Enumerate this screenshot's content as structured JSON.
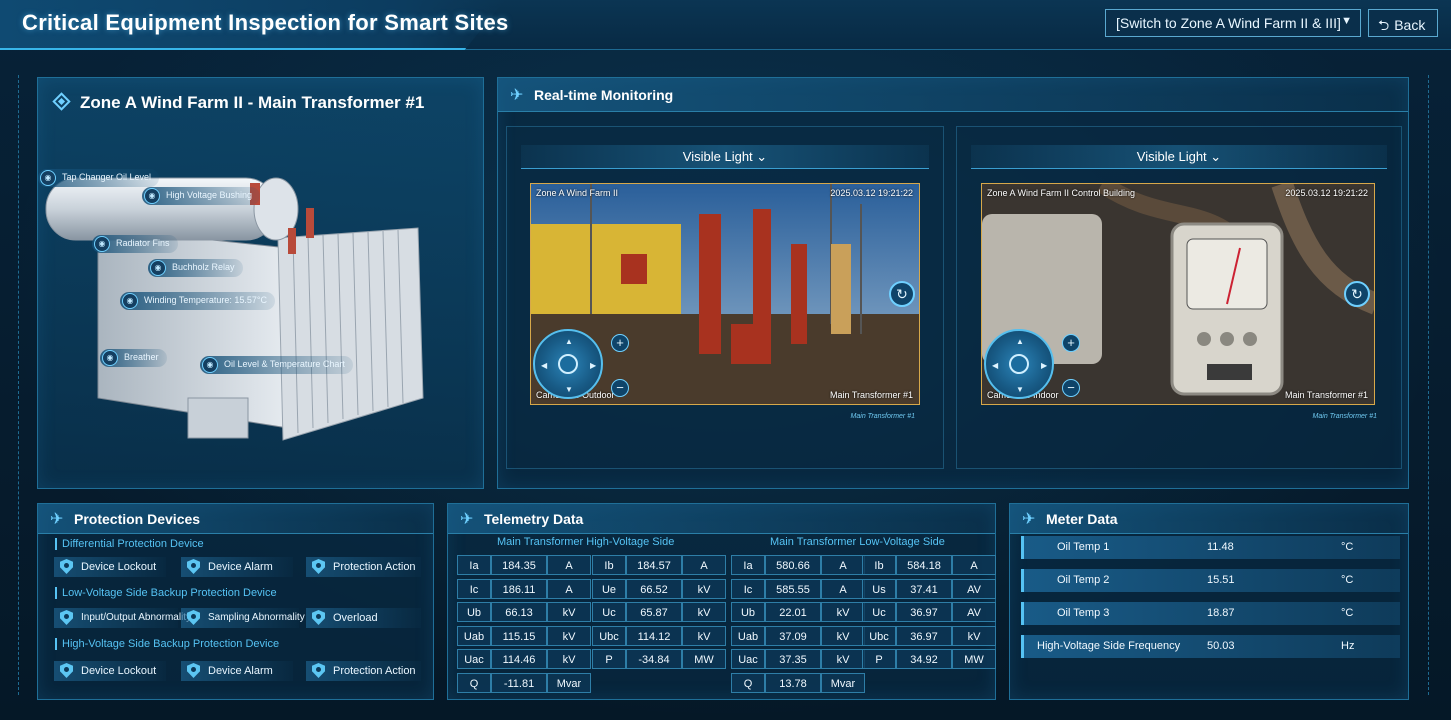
{
  "header": {
    "title": "Critical Equipment Inspection for Smart Sites",
    "switch_label": "[Switch to Zone A Wind Farm II & III]",
    "back_label": "Back"
  },
  "model": {
    "title": "Zone A Wind Farm II - Main Transformer #1",
    "tags": [
      "Tap Changer Oil Level",
      "High Voltage Bushing",
      "Radiator Fins",
      "Buchholz Relay",
      "Winding Temperature: 15.57°C",
      "Breather",
      "Oil Level & Temperature Chart"
    ]
  },
  "monitoring": {
    "title": "Real-time Monitoring",
    "cameras": [
      {
        "mode": "Visible Light",
        "location": "Zone A Wind Farm II",
        "timestamp": "2025.03.12  19:21:22",
        "camera_label": "Camera … Outdoor",
        "asset": "Main Transformer #1",
        "footer": "Main Transformer #1"
      },
      {
        "mode": "Visible Light",
        "location": "Zone A Wind Farm II Control Building",
        "timestamp": "2025.03.12  19:21:22",
        "camera_label": "Camera … Indoor",
        "asset": "Main Transformer #1",
        "footer": "Main Transformer #1"
      }
    ]
  },
  "protection": {
    "title": "Protection Devices",
    "groups": [
      {
        "label": "Differential Protection Device",
        "items": [
          "Device Lockout",
          "Device Alarm",
          "Protection Action"
        ]
      },
      {
        "label": "Low-Voltage Side Backup Protection Device",
        "items": [
          "Input/Output Abnormality",
          "Sampling Abnormality",
          "Overload"
        ]
      },
      {
        "label": "High-Voltage Side Backup Protection Device",
        "items": [
          "Device Lockout",
          "Device Alarm",
          "Protection Action"
        ]
      }
    ]
  },
  "telemetry": {
    "title": "Telemetry Data",
    "hv_title": "Main Transformer High-Voltage Side",
    "lv_title": "Main Transformer Low-Voltage Side",
    "hv_left": [
      [
        "Ia",
        "184.35",
        "A"
      ],
      [
        "Ic",
        "186.11",
        "A"
      ],
      [
        "Ub",
        "66.13",
        "kV"
      ],
      [
        "Uab",
        "115.15",
        "kV"
      ],
      [
        "Uac",
        "114.46",
        "kV"
      ],
      [
        "Q",
        "-11.81",
        "Mvar"
      ]
    ],
    "hv_right": [
      [
        "Ib",
        "184.57",
        "A"
      ],
      [
        "Ue",
        "66.52",
        "kV"
      ],
      [
        "Uc",
        "65.87",
        "kV"
      ],
      [
        "Ubc",
        "114.12",
        "kV"
      ],
      [
        "P",
        "-34.84",
        "MW"
      ]
    ],
    "lv_left": [
      [
        "Ia",
        "580.66",
        "A"
      ],
      [
        "Ic",
        "585.55",
        "A"
      ],
      [
        "Ub",
        "22.01",
        "kV"
      ],
      [
        "Uab",
        "37.09",
        "kV"
      ],
      [
        "Uac",
        "37.35",
        "kV"
      ],
      [
        "Q",
        "13.78",
        "Mvar"
      ]
    ],
    "lv_right": [
      [
        "Ib",
        "584.18",
        "A"
      ],
      [
        "Us",
        "37.41",
        "AV"
      ],
      [
        "Uc",
        "36.97",
        "AV"
      ],
      [
        "Ubc",
        "36.97",
        "kV"
      ],
      [
        "P",
        "34.92",
        "MW"
      ]
    ]
  },
  "meter": {
    "title": "Meter Data",
    "rows": [
      {
        "name": "Oil Temp 1",
        "value": "11.48",
        "unit": "°C"
      },
      {
        "name": "Oil Temp 2",
        "value": "15.51",
        "unit": "°C"
      },
      {
        "name": "Oil Temp 3",
        "value": "18.87",
        "unit": "°C"
      },
      {
        "name": "High-Voltage Side Frequency",
        "value": "50.03",
        "unit": "Hz"
      }
    ]
  }
}
